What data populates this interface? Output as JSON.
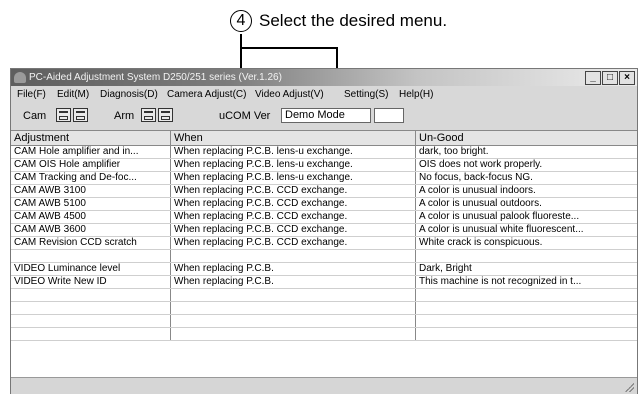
{
  "callout": {
    "number": "4",
    "text": "Select the desired menu."
  },
  "window": {
    "title": "PC-Aided Adjustment System D250/251 series (Ver.1.26)",
    "buttons": [
      "_",
      "□",
      "×"
    ]
  },
  "menu": [
    {
      "label": "File(F)"
    },
    {
      "label": "Edit(M)"
    },
    {
      "label": "Diagnosis(D)"
    },
    {
      "label": "Camera Adjust(C)"
    },
    {
      "label": "Video Adjust(V)"
    },
    {
      "label": "Setting(S)"
    },
    {
      "label": "Help(H)"
    }
  ],
  "toolbar": {
    "cam_label": "Cam",
    "arm_label": "Arm",
    "ucom_label": "uCOM Ver",
    "ucom_value": "Demo Mode",
    "extra_value": ""
  },
  "table": {
    "headers": [
      "Adjustment",
      "When",
      "Un-Good"
    ],
    "rows": [
      [
        "CAM Hole amplifier and in...",
        "When replacing P.C.B. lens-u exchange.",
        "dark, too bright."
      ],
      [
        "CAM OIS Hole amplifier",
        "When replacing P.C.B. lens-u exchange.",
        "OIS does not work properly."
      ],
      [
        "CAM Tracking and De-foc...",
        "When replacing P.C.B. lens-u exchange.",
        "No focus, back-focus NG."
      ],
      [
        "CAM AWB 3100",
        "When replacing P.C.B. CCD exchange.",
        "A color is unusual indoors."
      ],
      [
        "CAM AWB 5100",
        "When replacing P.C.B. CCD exchange.",
        "A color is unusual outdoors."
      ],
      [
        "CAM AWB 4500",
        "When replacing P.C.B. CCD exchange.",
        "A color is unusual palook fluoreste..."
      ],
      [
        "CAM AWB 3600",
        "When replacing P.C.B. CCD exchange.",
        "A color is unusual white fluorescent..."
      ],
      [
        "CAM Revision CCD scratch",
        "When replacing P.C.B. CCD exchange.",
        "White crack is conspicuous."
      ],
      [
        "",
        "",
        ""
      ],
      [
        "VIDEO Luminance level",
        "When replacing P.C.B.",
        "Dark, Bright"
      ],
      [
        "VIDEO Write New ID",
        "When replacing P.C.B.",
        "This machine is not recognized in t..."
      ],
      [
        "",
        "",
        ""
      ],
      [
        "",
        "",
        ""
      ],
      [
        "",
        "",
        ""
      ],
      [
        "",
        "",
        ""
      ]
    ]
  }
}
